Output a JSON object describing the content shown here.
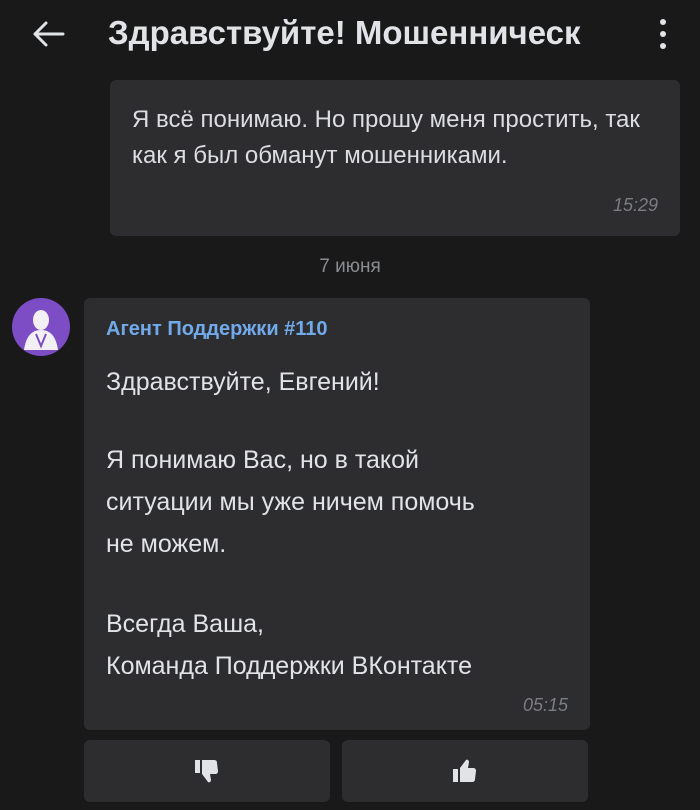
{
  "header": {
    "title": "Здравствуйте! Мошенническ",
    "back_icon": "arrow-left-icon",
    "menu_icon": "more-vertical-icon"
  },
  "messages": [
    {
      "direction": "outgoing",
      "text": "Я всё понимаю. Но прошу меня простить, так как я был обманут мошенниками.",
      "time": "15:29"
    },
    {
      "direction": "incoming",
      "sender": "Агент Поддержки #110",
      "lines": [
        "Здравствуйте, Евгений!",
        "",
        "Я понимаю Вас, но в такой",
        "ситуации мы уже ничем помочь",
        "не можем.",
        "",
        "Всегда Ваша,",
        "Команда Поддержки ВКонтакте"
      ],
      "time": "05:15"
    }
  ],
  "date_separator": "7 июня",
  "rating": {
    "dislike_icon": "thumbs-down-icon",
    "like_icon": "thumbs-up-icon"
  },
  "colors": {
    "background": "#19191a",
    "bubble": "#2d2d2f",
    "sender_name": "#71aaeb",
    "avatar": "#7c4dc4"
  }
}
